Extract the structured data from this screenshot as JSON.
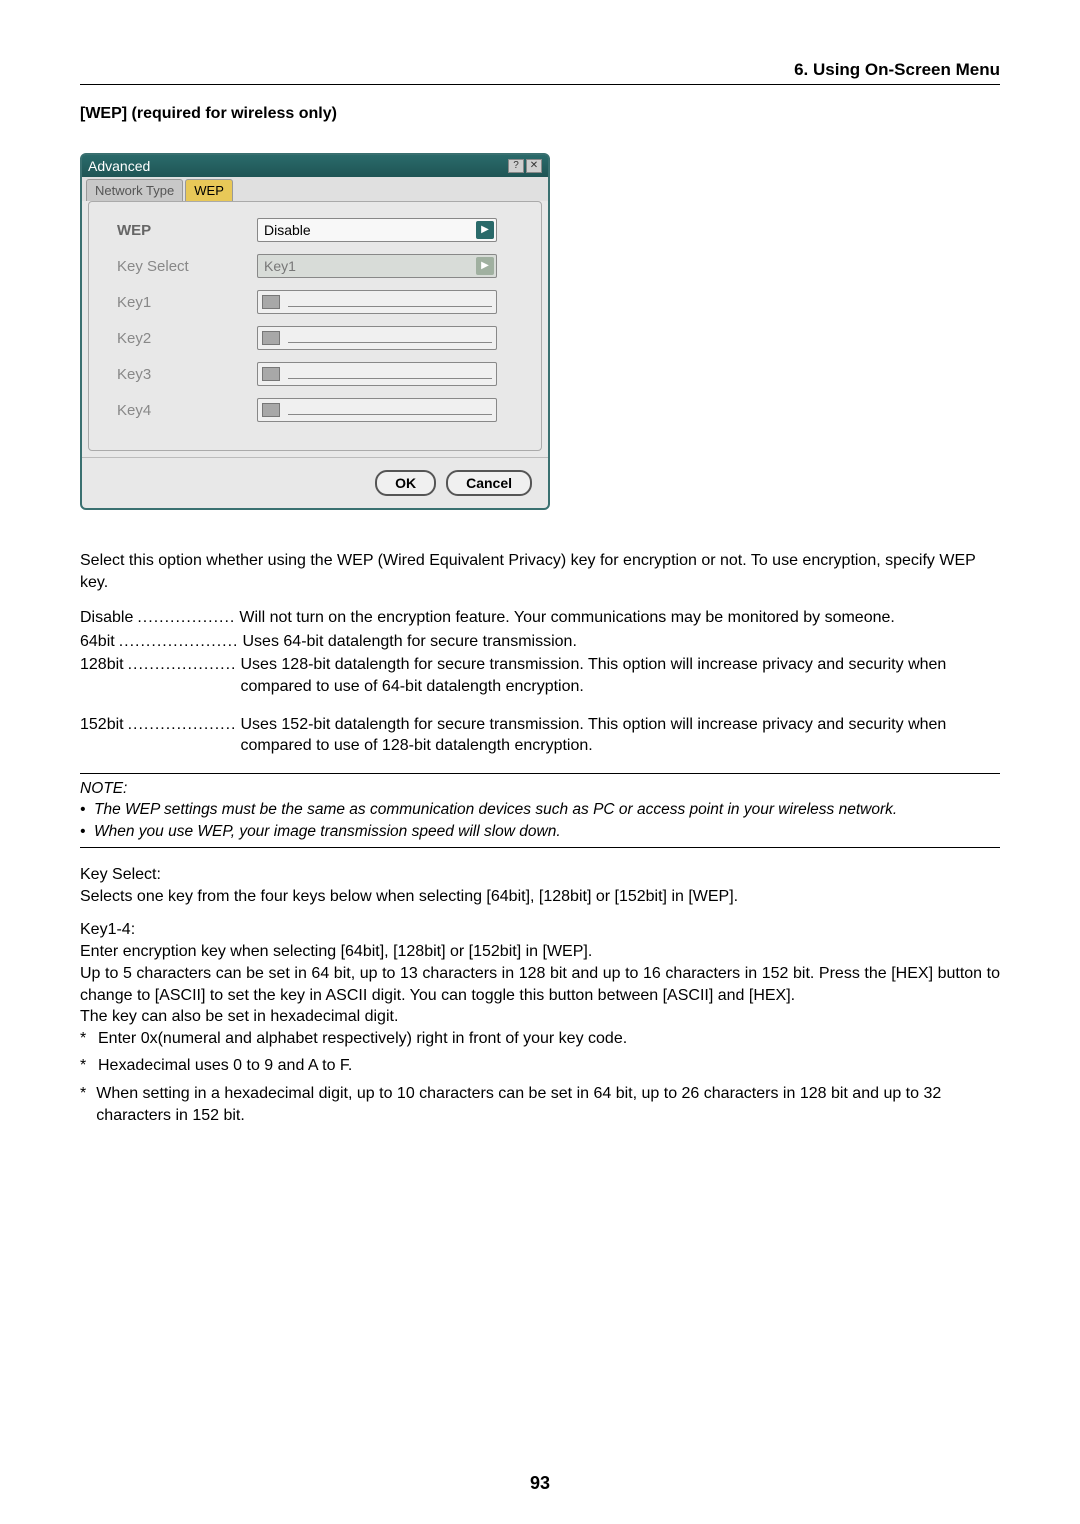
{
  "header": {
    "chapter": "6. Using On-Screen Menu"
  },
  "section_title": "[WEP] (required for wireless only)",
  "dialog": {
    "title": "Advanced",
    "tabs": {
      "network": "Network Type",
      "wep": "WEP"
    },
    "rows": {
      "wep_label": "WEP",
      "wep_value": "Disable",
      "keysel_label": "Key Select",
      "keysel_value": "Key1",
      "k1": "Key1",
      "k2": "Key2",
      "k3": "Key3",
      "k4": "Key4"
    },
    "buttons": {
      "ok": "OK",
      "cancel": "Cancel"
    }
  },
  "body": {
    "intro": "Select this option whether using the WEP (Wired Equivalent Privacy) key for encryption or not. To use encryption, specify WEP key.",
    "defs": {
      "disable_t": "Disable",
      "disable_d": "Will not turn on the encryption feature. Your communications may be monitored by someone.",
      "b64_t": "64bit",
      "b64_d": "Uses 64-bit datalength for secure transmission.",
      "b128_t": "128bit",
      "b128_d": "Uses 128-bit datalength for secure transmission. This option will increase privacy and security when compared to use of 64-bit datalength encryption.",
      "b152_t": "152bit",
      "b152_d": "Uses 152-bit datalength for secure transmission. This option will increase privacy and security when compared to use of 128-bit datalength encryption."
    },
    "note": {
      "heading": "NOTE:",
      "l1": "The WEP settings must be the same as communication devices such as PC or access point in your wireless network.",
      "l2": "When you use WEP, your image transmission speed will slow down."
    },
    "keyselect": {
      "h": "Key Select:",
      "t": "Selects one key from the four keys below when selecting [64bit], [128bit] or [152bit] in [WEP]."
    },
    "key14": {
      "h": "Key1-4:",
      "p1": "Enter encryption key when selecting [64bit], [128bit] or [152bit] in [WEP].",
      "p2": "Up to 5 characters can be set in 64 bit, up to 13 characters in 128 bit and up to 16 characters in 152 bit. Press the [HEX] button to change to [ASCII] to set the key in ASCII digit. You can toggle this button between [ASCII] and [HEX].",
      "p3": "The key can also be set in hexadecimal digit.",
      "s1": "Enter 0x(numeral and alphabet respectively) right in front of your key code.",
      "s2": "Hexadecimal uses 0 to 9 and A to F.",
      "s3": "When setting in a hexadecimal digit, up to 10 characters can be set in 64 bit, up to 26 characters in 128 bit and up to 32 characters in 152 bit."
    }
  },
  "page_number": "93"
}
